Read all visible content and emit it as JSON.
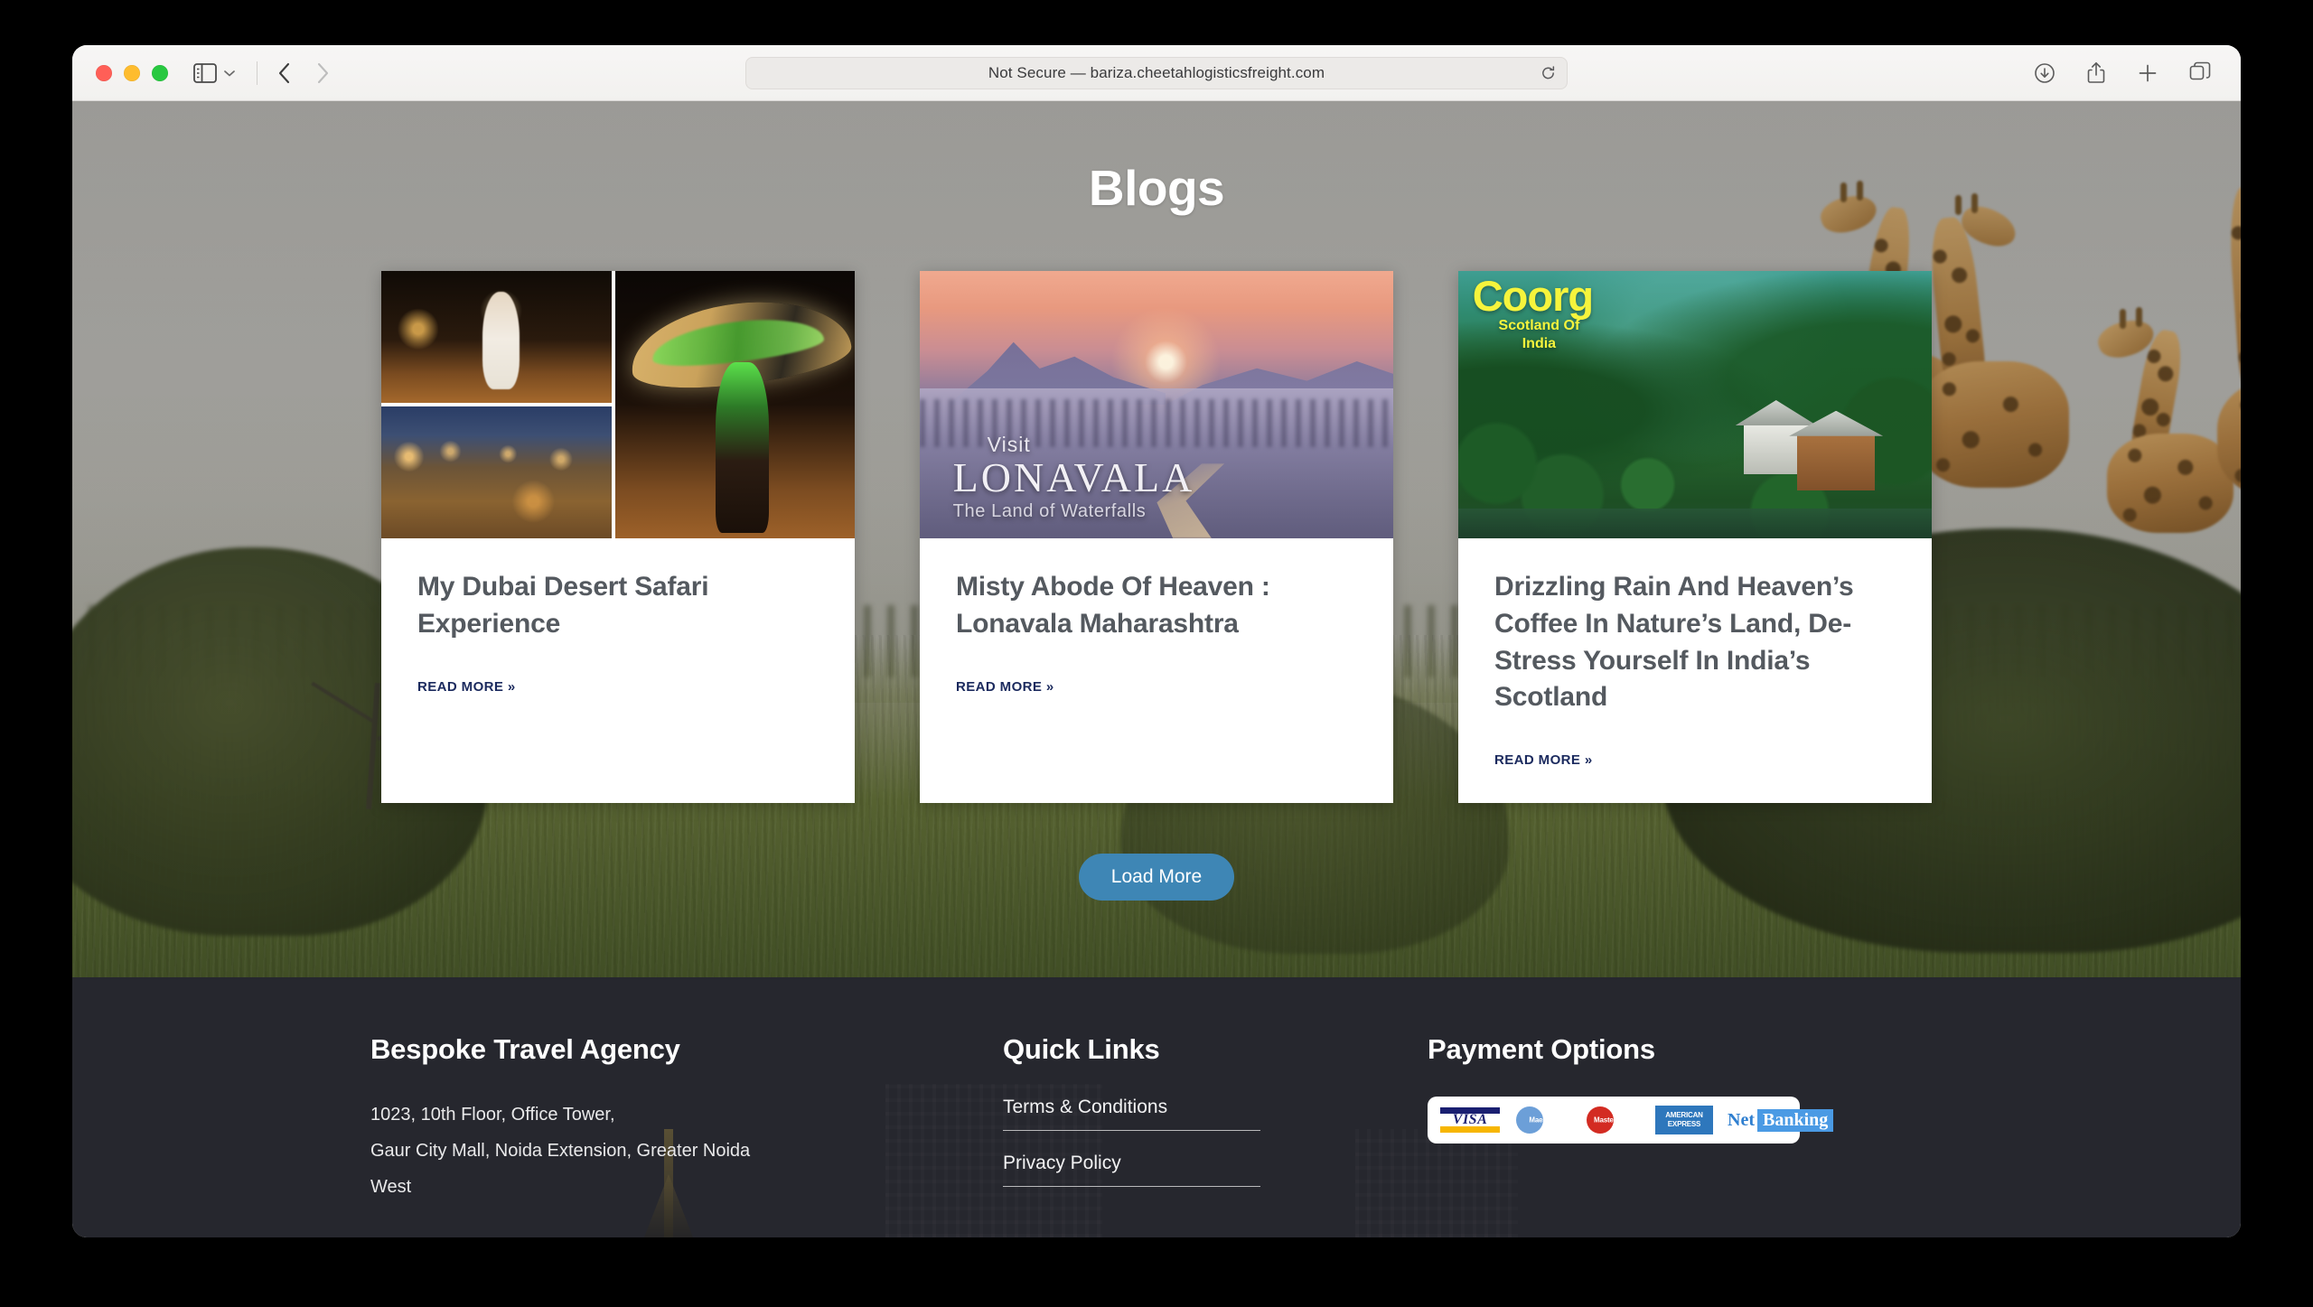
{
  "browser": {
    "url_text": "Not Secure — bariza.cheetahlogisticsfreight.com",
    "traffic_lights": [
      "close",
      "minimize",
      "zoom"
    ],
    "icons": {
      "sidebar": "sidebar-icon",
      "sidebar_chevron": "chevron-down-icon",
      "back": "back-arrow-icon",
      "forward": "forward-arrow-icon",
      "reload": "reload-icon",
      "downloads": "download-icon",
      "share": "share-icon",
      "new_tab": "plus-icon",
      "tab_overview": "tab-overview-icon"
    }
  },
  "page": {
    "title": "Blogs",
    "cards": [
      {
        "title": "My Dubai Desert Safari Experience",
        "read_more": "READ MORE »",
        "image_alt": "dubai-desert-safari-collage"
      },
      {
        "title": "Misty Abode Of Heaven : Lonavala Maharashtra",
        "read_more": "READ MORE »",
        "image_alt": "lonavala-sunrise-poster",
        "overlay": {
          "kicker": "Visit",
          "name": "LONAVALA",
          "tagline": "The Land of Waterfalls"
        }
      },
      {
        "title": "Drizzling Rain And Heaven’s Coffee In Nature’s Land, De-Stress Yourself In India’s Scotland",
        "read_more": "READ MORE »",
        "image_alt": "coorg-green-valley-poster",
        "overlay": {
          "name": "Coorg",
          "sub_line1": "Scotland Of",
          "sub_line2": "India"
        }
      }
    ],
    "load_more_label": "Load More",
    "accent_button_color": "#3e86b5"
  },
  "footer": {
    "background_color": "#26272e",
    "company": {
      "heading": "Bespoke Travel Agency",
      "address_line1": "1023, 10th Floor, Office Tower,",
      "address_line2": "Gaur City Mall, Noida Extension, Greater Noida",
      "address_line3": "West"
    },
    "quick_links": {
      "heading": "Quick Links",
      "items": [
        {
          "label": "Terms & Conditions"
        },
        {
          "label": "Privacy Policy"
        }
      ]
    },
    "payment": {
      "heading": "Payment Options",
      "methods": [
        {
          "name": "visa-logo",
          "label": "VISA"
        },
        {
          "name": "maestro-logo",
          "label": "Maestro"
        },
        {
          "name": "mastercard-logo",
          "label": "MasterCard"
        },
        {
          "name": "amex-logo",
          "label": "AMERICAN EXPRESS"
        },
        {
          "name": "netbanking-logo",
          "label_part1": "Net",
          "label_part2": "Banking"
        }
      ]
    }
  }
}
